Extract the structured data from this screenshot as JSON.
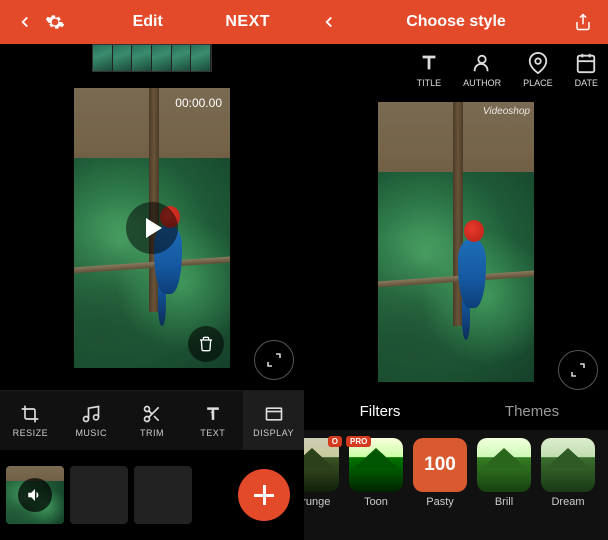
{
  "left": {
    "topbar": {
      "edit_label": "Edit",
      "next_label": "NEXT"
    },
    "preview": {
      "timecode": "00:00.00"
    },
    "tools": [
      {
        "label": "RESIZE",
        "icon": "crop"
      },
      {
        "label": "MUSIC",
        "icon": "music"
      },
      {
        "label": "TRIM",
        "icon": "scissors"
      },
      {
        "label": "TEXT",
        "icon": "text"
      },
      {
        "label": "DISPLAY",
        "icon": "display"
      }
    ]
  },
  "right": {
    "topbar": {
      "title": "Choose style"
    },
    "meta": [
      {
        "label": "TITLE",
        "icon": "title"
      },
      {
        "label": "AUTHOR",
        "icon": "author"
      },
      {
        "label": "PLACE",
        "icon": "place"
      },
      {
        "label": "DATE",
        "icon": "date"
      }
    ],
    "watermark": "Videoshop",
    "tabs": {
      "filters": "Filters",
      "themes": "Themes"
    },
    "filters": [
      {
        "label": "Grunge",
        "pro": true,
        "kind": "grunge"
      },
      {
        "label": "Toon",
        "pro": true,
        "kind": "toon"
      },
      {
        "label": "Pasty",
        "pro": false,
        "kind": "pasty",
        "badge": "100"
      },
      {
        "label": "Brill",
        "pro": false,
        "kind": "brill"
      },
      {
        "label": "Dream",
        "pro": false,
        "kind": "dream"
      }
    ]
  },
  "pro_label": "PRO"
}
